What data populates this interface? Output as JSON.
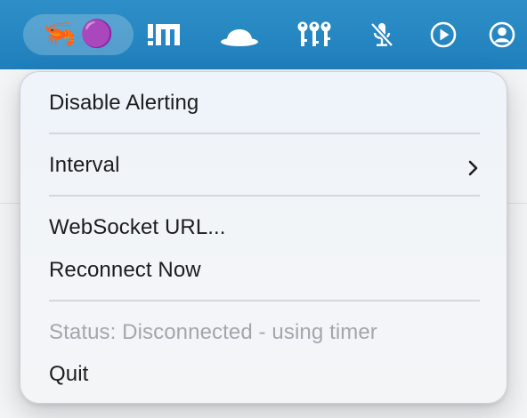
{
  "menu_bar": {
    "icons": [
      {
        "name": "shrimp-emoji-icon",
        "glyph": "🦐"
      },
      {
        "name": "purple-circle-icon",
        "glyph": "🟣"
      },
      {
        "name": "exclaim-m-app-icon"
      },
      {
        "name": "bowler-hat-icon"
      },
      {
        "name": "keys-icon"
      },
      {
        "name": "microphone-muted-icon"
      },
      {
        "name": "play-circle-icon"
      },
      {
        "name": "user-account-icon"
      }
    ],
    "background_color": "#2283c0"
  },
  "menu": {
    "items": [
      {
        "label": "Disable Alerting"
      },
      {
        "label": "Interval",
        "submenu": true
      },
      {
        "label": "WebSocket URL..."
      },
      {
        "label": "Reconnect Now"
      },
      {
        "label": "Status: Disconnected - using timer",
        "disabled": true
      },
      {
        "label": "Quit"
      }
    ]
  }
}
